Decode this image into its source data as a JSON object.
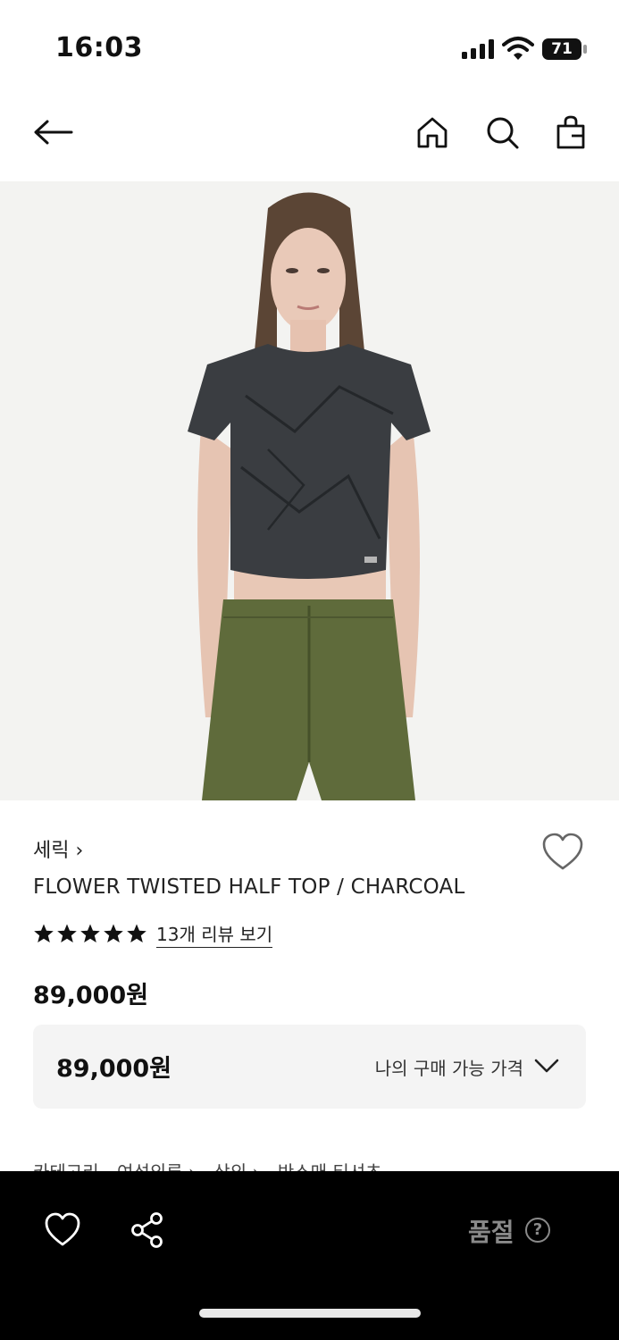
{
  "status_bar": {
    "time": "16:03",
    "battery": "71"
  },
  "nav": {
    "back_icon": "arrow-left-icon",
    "home_icon": "home-icon",
    "search_icon": "search-icon",
    "bag_icon": "shopping-bag-icon"
  },
  "hero": {
    "icon": "product-photo"
  },
  "product": {
    "brand": "세릭 ›",
    "title": "FLOWER TWISTED HALF TOP / CHARCOAL",
    "rating_stars": 5,
    "review_link": "13개 리뷰 보기",
    "price": "89,000원",
    "price_box": {
      "amount": "89,000원",
      "label": "나의 구매 가능 가격"
    }
  },
  "category": {
    "items": [
      "카테고리",
      "여성의류 ›",
      "상의 ›",
      "반소매 티셔츠"
    ]
  },
  "bottom_bar": {
    "soldout_label": "품절",
    "help_symbol": "?"
  },
  "colors": {
    "bottom_bar_bg": "#000000",
    "soldout_text": "#8a8a8a",
    "price_box_bg": "#f4f4f4"
  }
}
